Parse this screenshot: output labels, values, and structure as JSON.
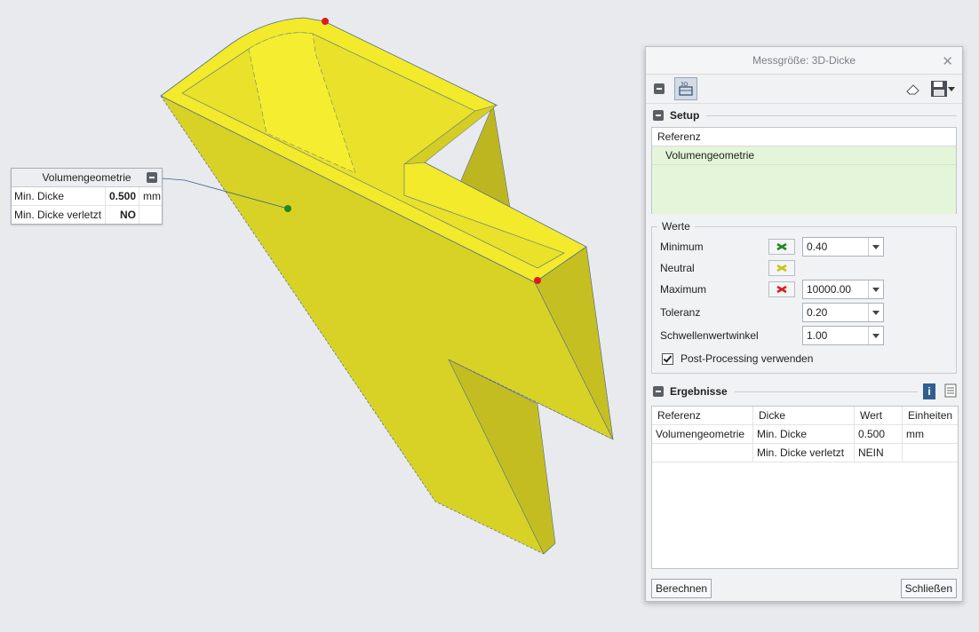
{
  "callout": {
    "title": "Volumengeometrie",
    "rows": [
      {
        "label": "Min. Dicke",
        "value": "0.500",
        "unit": "mm"
      },
      {
        "label": "Min. Dicke verletzt",
        "value": "NO",
        "unit": ""
      }
    ]
  },
  "dialog": {
    "title": "Messgröße: 3D-Dicke",
    "close_symbol": "✕",
    "toolbar": {
      "collapse_icon": "minus-icon",
      "thickness_icon": "3d-thickness-icon",
      "thickness_icon_text": "3D",
      "eraser_icon": "eraser-icon",
      "save_icon": "save-icon"
    },
    "setup": {
      "heading": "Setup",
      "table_header": "Referenz",
      "rows": [
        "Volumengeometrie"
      ]
    },
    "werte": {
      "legend": "Werte",
      "minimum_label": "Minimum",
      "minimum_value": "0.40",
      "neutral_label": "Neutral",
      "maximum_label": "Maximum",
      "maximum_value": "10000.00",
      "toleranz_label": "Toleranz",
      "toleranz_value": "0.20",
      "winkel_label": "Schwellenwertwinkel",
      "winkel_value": "1.00",
      "postprocessing_label": "Post-Processing verwenden",
      "postprocessing_checked": true,
      "colors": {
        "minimum": "#1e8a1e",
        "neutral": "#c9c21a",
        "maximum": "#d42020"
      }
    },
    "ergebnisse": {
      "heading": "Ergebnisse",
      "info_icon": "info-icon",
      "report_icon": "report-icon",
      "columns": [
        "Referenz",
        "Dicke",
        "Wert",
        "Einheiten"
      ],
      "rows": [
        [
          "Volumengeometrie",
          "Min. Dicke",
          "0.500",
          "mm"
        ],
        [
          "",
          "Min. Dicke verletzt",
          "NEIN",
          ""
        ]
      ]
    },
    "buttons": {
      "compute": "Berechnen",
      "close": "Schließen"
    }
  }
}
